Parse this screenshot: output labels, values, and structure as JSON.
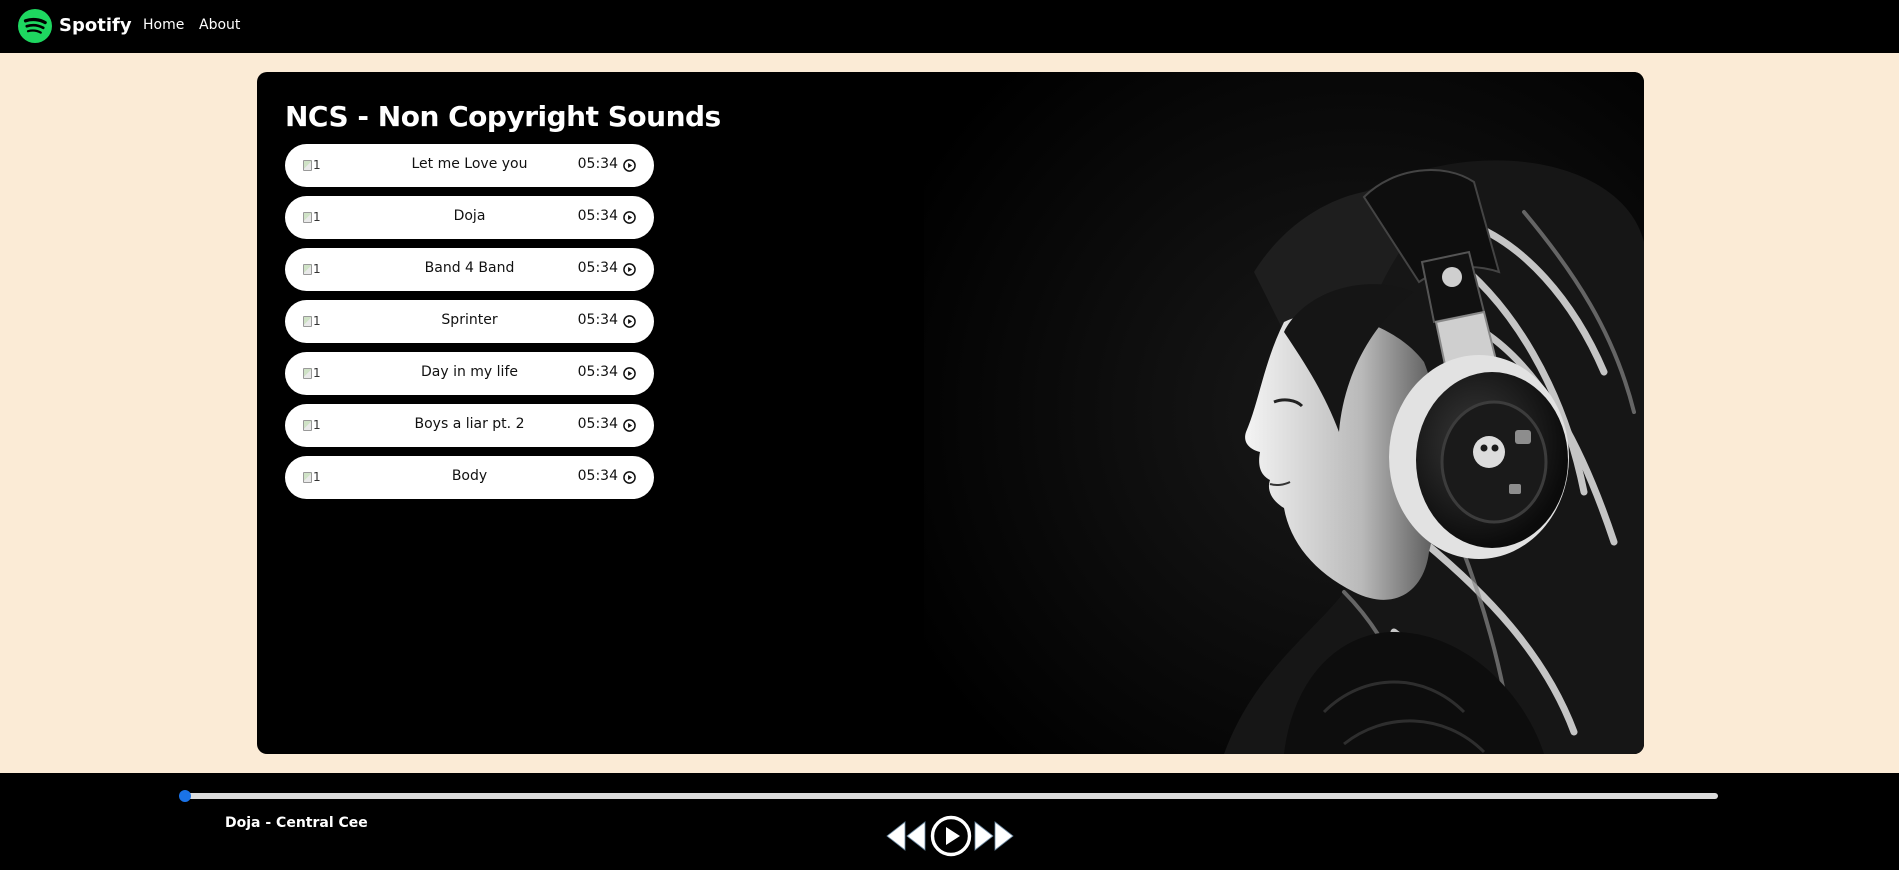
{
  "nav": {
    "brand": "Spotify",
    "links": [
      "Home",
      "About"
    ]
  },
  "playlist": {
    "title": "NCS - Non Copyright Sounds",
    "songs": [
      {
        "img_alt": "1",
        "name": "Let me Love you",
        "duration": "05:34"
      },
      {
        "img_alt": "1",
        "name": "Doja",
        "duration": "05:34"
      },
      {
        "img_alt": "1",
        "name": "Band 4 Band",
        "duration": "05:34"
      },
      {
        "img_alt": "1",
        "name": "Sprinter",
        "duration": "05:34"
      },
      {
        "img_alt": "1",
        "name": "Day in my life",
        "duration": "05:34"
      },
      {
        "img_alt": "1",
        "name": "Boys a liar pt. 2",
        "duration": "05:34"
      },
      {
        "img_alt": "1",
        "name": "Body",
        "duration": "05:34"
      }
    ]
  },
  "player": {
    "now_playing": "Doja - Central Cee",
    "progress_percent": 0
  },
  "icons": {
    "logo": "spotify-logo-icon",
    "song_play": "play-circle-icon",
    "previous": "previous-icon",
    "play": "play-icon",
    "next": "next-icon"
  },
  "colors": {
    "page_background": "#fbebd6",
    "bar_background": "#000000",
    "brand_green": "#1ed760",
    "progress_thumb": "#1a73e8"
  }
}
